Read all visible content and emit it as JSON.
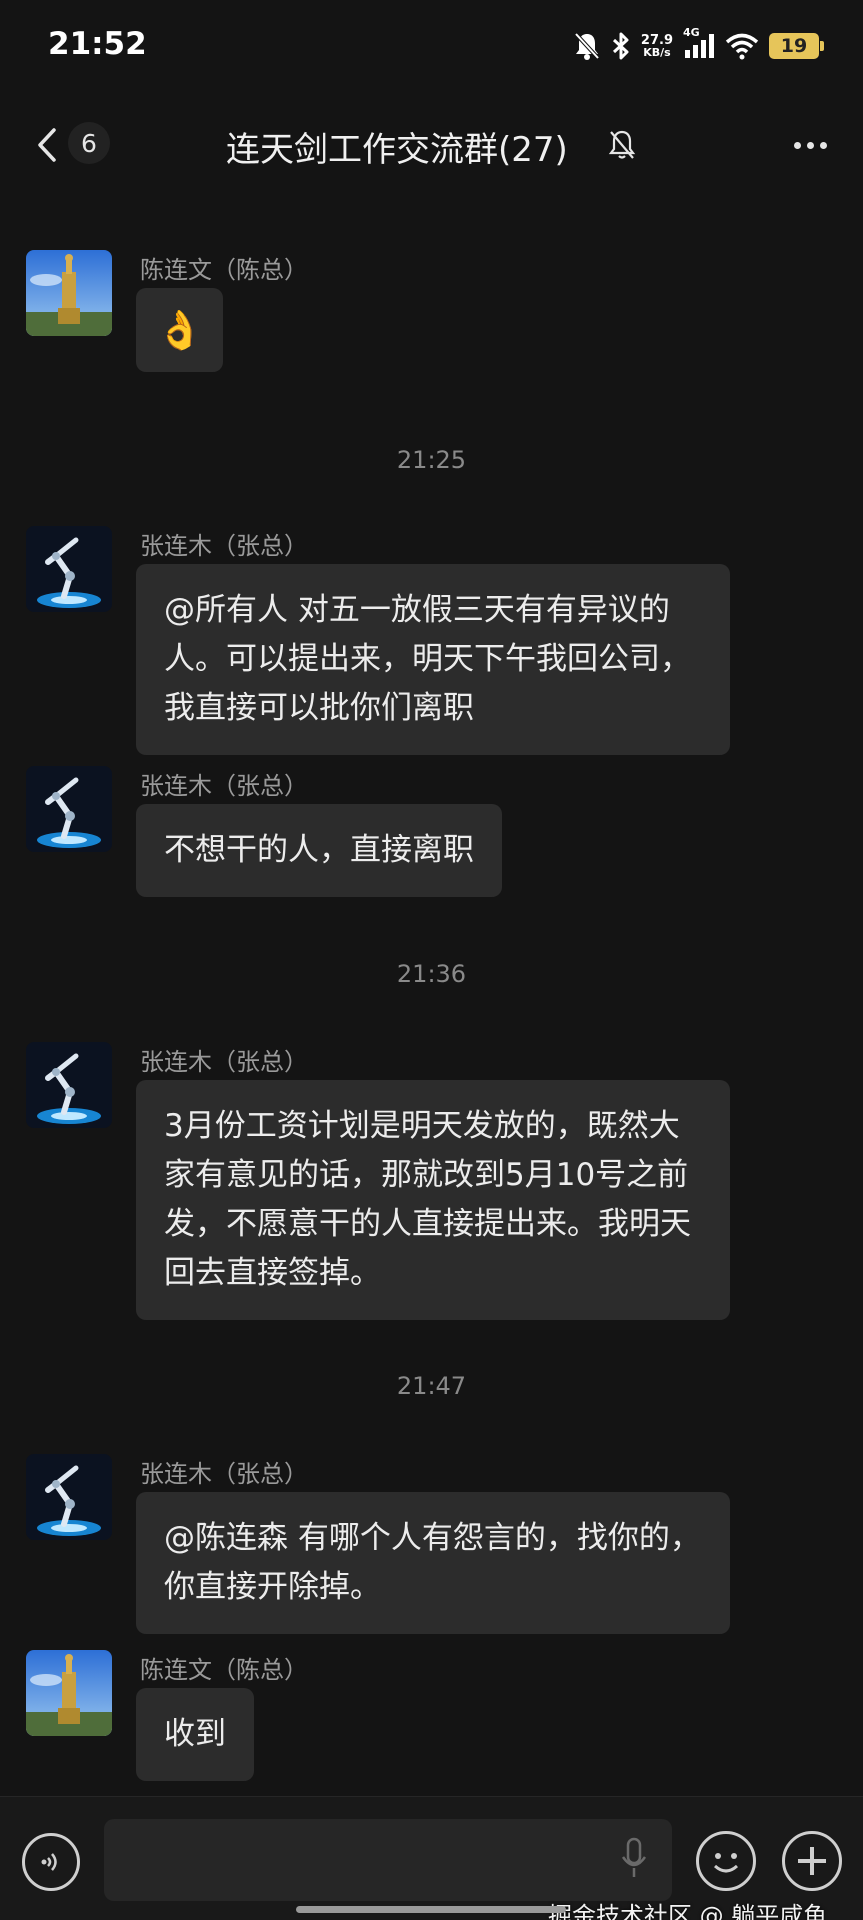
{
  "status_bar": {
    "time": "21:52",
    "net_speed_value": "27.9",
    "net_speed_unit": "KB/s",
    "network_type": "4G",
    "battery": "19",
    "icons": [
      "mute-notification-icon",
      "bluetooth-icon",
      "signal-icon",
      "wifi-icon",
      "battery-icon"
    ]
  },
  "nav": {
    "unread_count": "6",
    "title": "连天剑工作交流群(27)",
    "icons": [
      "back-chevron-icon",
      "mute-bell-icon",
      "more-dots-icon"
    ]
  },
  "messages": [
    {
      "sender": "陈连文（陈总）",
      "text": "👌",
      "avatar": "monument-avatar"
    },
    {
      "divider": "21:25"
    },
    {
      "sender": "张连木（张总）",
      "text": "@所有人  对五一放假三天有有异议的人。可以提出来，明天下午我回公司，我直接可以批你们离职",
      "avatar": "robot-arm-avatar"
    },
    {
      "sender": "张连木（张总）",
      "text": "不想干的人，直接离职",
      "avatar": "robot-arm-avatar"
    },
    {
      "divider": "21:36"
    },
    {
      "sender": "张连木（张总）",
      "text": "3月份工资计划是明天发放的，既然大家有意见的话，那就改到5月10号之前发，不愿意干的人直接提出来。我明天回去直接签掉。",
      "avatar": "robot-arm-avatar"
    },
    {
      "divider": "21:47"
    },
    {
      "sender": "张连木（张总）",
      "text": "@陈连森  有哪个人有怨言的，找你的，你直接开除掉。",
      "avatar": "robot-arm-avatar"
    },
    {
      "sender": "陈连文（陈总）",
      "text": "收到",
      "avatar": "monument-avatar"
    }
  ],
  "input_bar": {
    "icons": [
      "voice-icon",
      "mic-icon",
      "emoji-icon",
      "plus-icon"
    ]
  },
  "watermark": "掘金技术社区 @ 躺平咸鱼",
  "colors": {
    "background": "#141414",
    "bubble": "#2c2c2c",
    "battery": "#e6c55a"
  }
}
